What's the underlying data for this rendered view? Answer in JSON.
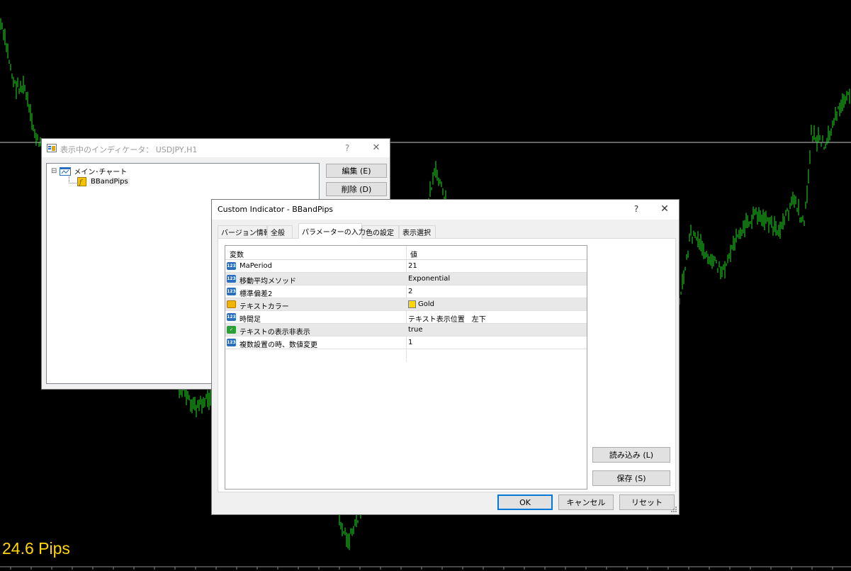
{
  "chart": {
    "line_color": "#22dd22",
    "bg_color": "#000000",
    "pips_text": "24.6 Pips",
    "pips_color": "#ffd700"
  },
  "indicators_window": {
    "title": "表示中のインディケータ： USDJPY,H1",
    "help_label": "?",
    "close_label": "✕",
    "tree": {
      "root_label": "メイン･チャート",
      "child_label": "BBandPips",
      "expander": "⊟"
    },
    "edit_label": "編集 (E)",
    "delete_label": "削除 (D)"
  },
  "dialog": {
    "title": "Custom Indicator - BBandPips",
    "help_label": "?",
    "close_label": "✕",
    "tabs": [
      {
        "label": "バージョン情報"
      },
      {
        "label": "全般"
      },
      {
        "label": "パラメーターの入力"
      },
      {
        "label": "色の設定"
      },
      {
        "label": "表示選択"
      }
    ],
    "active_tab": "パラメーターの入力",
    "grid": {
      "col_variable": "変数",
      "col_value": "値",
      "rows": [
        {
          "icon": "number-icon",
          "icon_text": "123",
          "name": "MaPeriod",
          "value": "21"
        },
        {
          "icon": "number-icon",
          "icon_text": "123",
          "name": "移動平均メソッド",
          "value": "Exponential"
        },
        {
          "icon": "number-icon",
          "icon_text": "123",
          "name": "標準偏差2",
          "value": "2"
        },
        {
          "icon": "color-icon",
          "icon_text": "",
          "name": "テキストカラー",
          "value": "Gold",
          "swatch": "#ffd700"
        },
        {
          "icon": "number-icon",
          "icon_text": "123",
          "name": "時間足",
          "value": "テキスト表示位置　左下"
        },
        {
          "icon": "bool-icon",
          "icon_text": "✓",
          "name": "テキストの表示非表示",
          "value": "true"
        },
        {
          "icon": "number-icon",
          "icon_text": "123",
          "name": "複数設置の時、数値変更",
          "value": "1"
        }
      ]
    },
    "load_label": "読み込み (L)",
    "save_label": "保存 (S)",
    "ok_label": "OK",
    "cancel_label": "キャンセル",
    "reset_label": "リセット"
  }
}
